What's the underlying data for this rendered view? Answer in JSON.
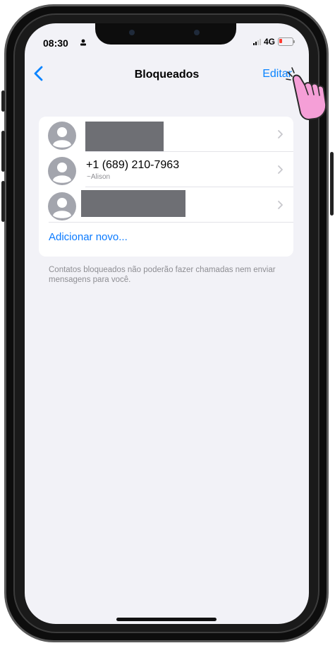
{
  "status_bar": {
    "time": "08:30",
    "network": "4G"
  },
  "nav": {
    "title": "Bloqueados",
    "edit_label": "Editar"
  },
  "blocked_list": {
    "rows": [
      {
        "name": "",
        "sub": "",
        "redacted": true
      },
      {
        "name": "+1 (689) 210-7963",
        "sub": "~Alison",
        "redacted": false
      },
      {
        "name": "",
        "sub": "",
        "redacted": true
      }
    ],
    "add_new_label": "Adicionar novo..."
  },
  "footer_note": "Contatos bloqueados não poderão fazer chamadas nem enviar mensagens para você.",
  "colors": {
    "accent": "#0a84ff",
    "background": "#f2f2f7",
    "redaction": "#6e6f74",
    "cursor": "#f59fd7"
  },
  "icons": [
    "back-chevron-icon",
    "contact-avatar-icon",
    "chevron-right-icon",
    "signal-icon",
    "battery-icon",
    "hand-pointer-icon"
  ]
}
